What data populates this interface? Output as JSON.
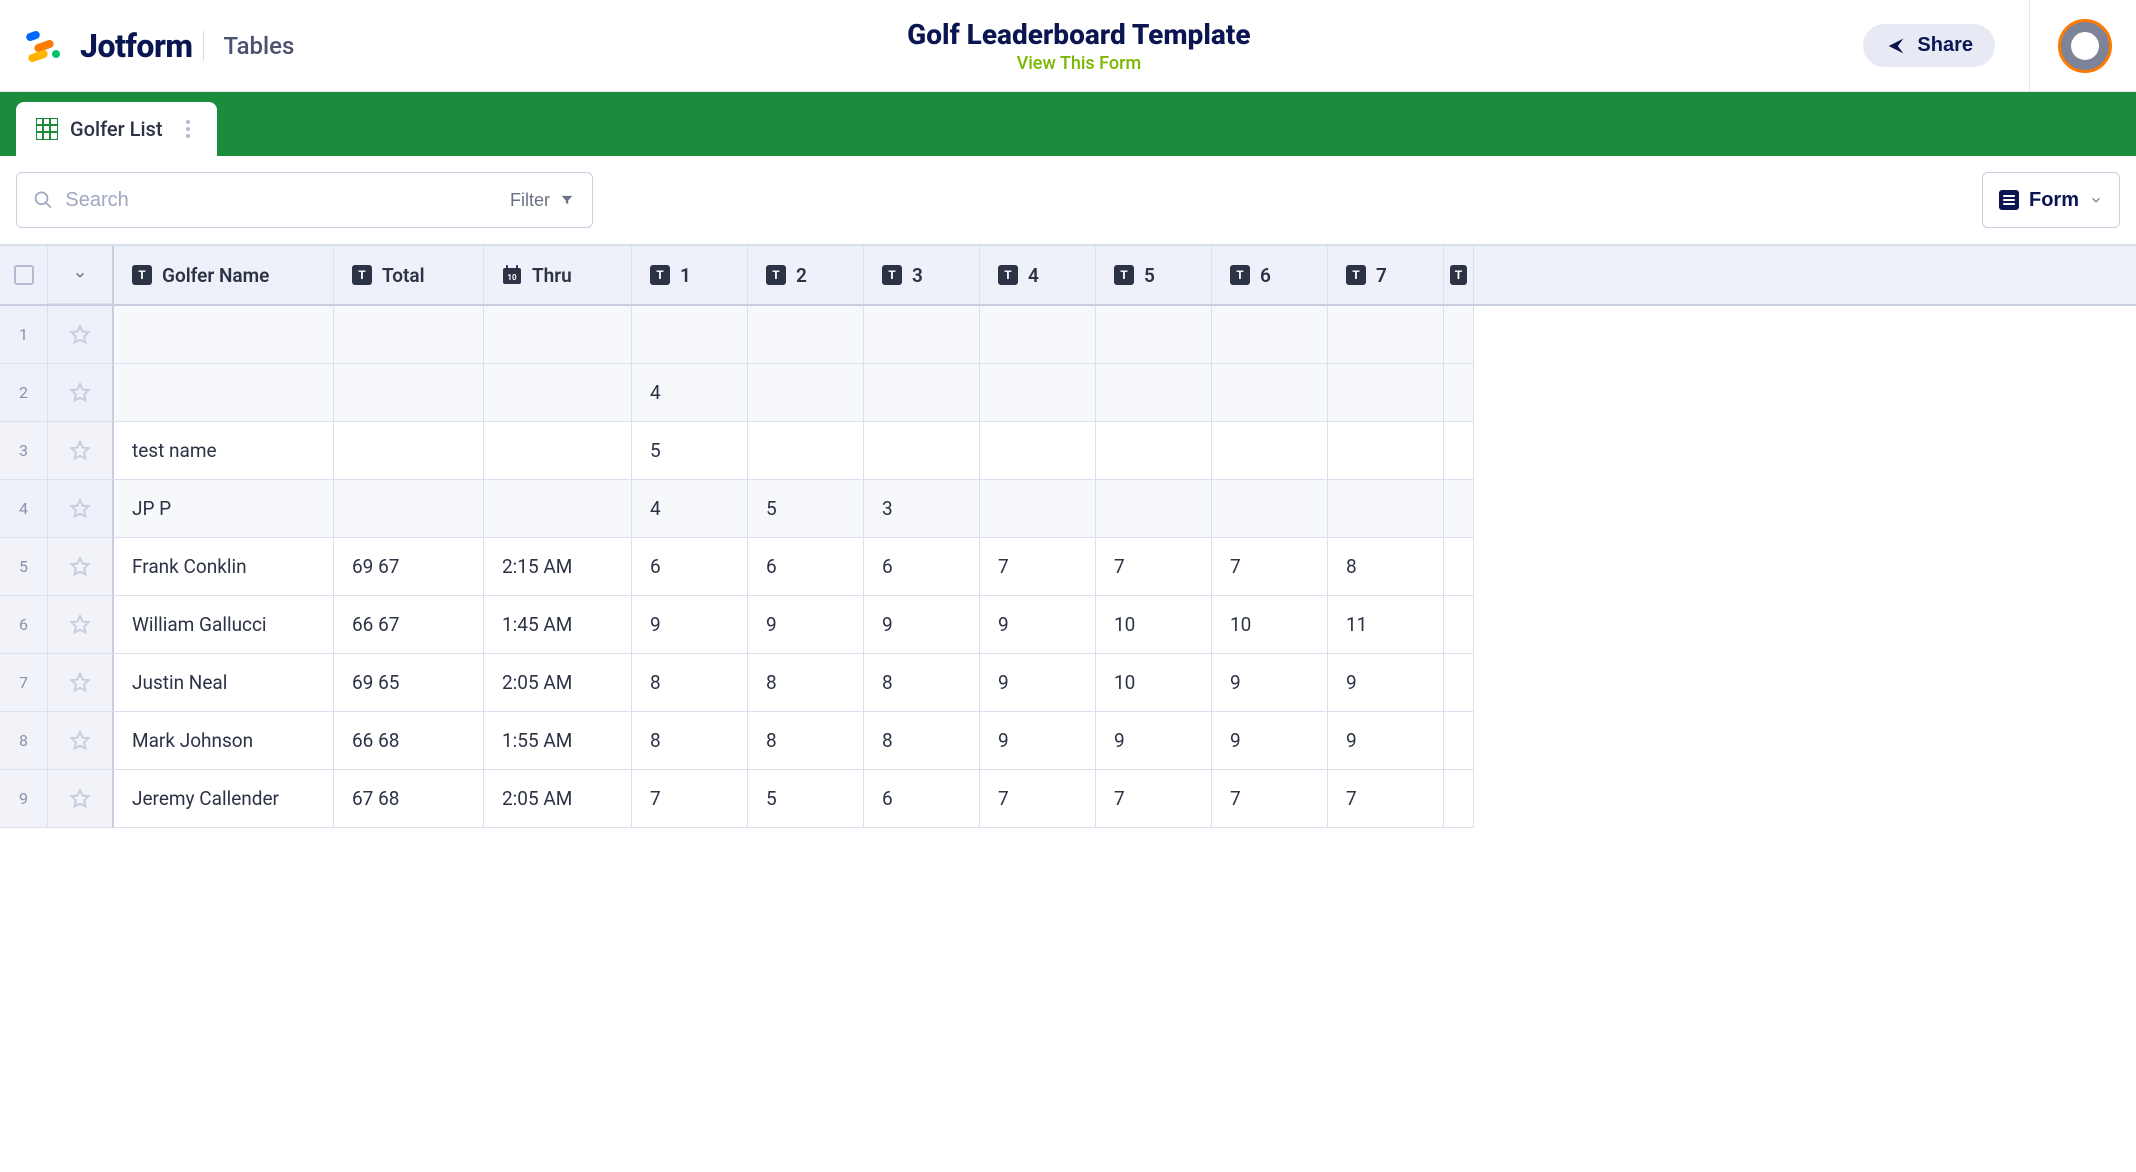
{
  "header": {
    "brand_word": "Jotform",
    "tables_label": "Tables",
    "title": "Golf Leaderboard Template",
    "view_form_label": "View This Form",
    "share_label": "Share"
  },
  "tab": {
    "label": "Golfer List"
  },
  "toolbar": {
    "search_placeholder": "Search",
    "filter_label": "Filter",
    "view_label": "Form"
  },
  "columns": {
    "golfer_name": "Golfer Name",
    "total": "Total",
    "thru": "Thru",
    "holes": [
      "1",
      "2",
      "3",
      "4",
      "5",
      "6",
      "7"
    ]
  },
  "rows": [
    {
      "num": "1",
      "name": "",
      "total": "",
      "thru": "",
      "holes": [
        "",
        "",
        "",
        "",
        "",
        "",
        ""
      ],
      "shaded": true
    },
    {
      "num": "2",
      "name": "",
      "total": "",
      "thru": "",
      "holes": [
        "4",
        "",
        "",
        "",
        "",
        "",
        ""
      ],
      "shaded": true
    },
    {
      "num": "3",
      "name": "test name",
      "total": "",
      "thru": "",
      "holes": [
        "5",
        "",
        "",
        "",
        "",
        "",
        ""
      ],
      "shaded": false
    },
    {
      "num": "4",
      "name": "JP P",
      "total": "",
      "thru": "",
      "holes": [
        "4",
        "5",
        "3",
        "",
        "",
        "",
        ""
      ],
      "shaded": true
    },
    {
      "num": "5",
      "name": "Frank Conklin",
      "total": "69 67",
      "thru": "2:15 AM",
      "holes": [
        "6",
        "6",
        "6",
        "7",
        "7",
        "7",
        "8"
      ],
      "shaded": false
    },
    {
      "num": "6",
      "name": "William Gallucci",
      "total": "66 67",
      "thru": "1:45 AM",
      "holes": [
        "9",
        "9",
        "9",
        "9",
        "10",
        "10",
        "11"
      ],
      "shaded": false
    },
    {
      "num": "7",
      "name": "Justin Neal",
      "total": "69 65",
      "thru": "2:05 AM",
      "holes": [
        "8",
        "8",
        "8",
        "9",
        "10",
        "9",
        "9"
      ],
      "shaded": false
    },
    {
      "num": "8",
      "name": "Mark Johnson",
      "total": "66 68",
      "thru": "1:55 AM",
      "holes": [
        "8",
        "8",
        "8",
        "9",
        "9",
        "9",
        "9"
      ],
      "shaded": false
    },
    {
      "num": "9",
      "name": "Jeremy Callender",
      "total": "67 68",
      "thru": "2:05 AM",
      "holes": [
        "7",
        "5",
        "6",
        "7",
        "7",
        "7",
        "7"
      ],
      "shaded": false
    }
  ]
}
